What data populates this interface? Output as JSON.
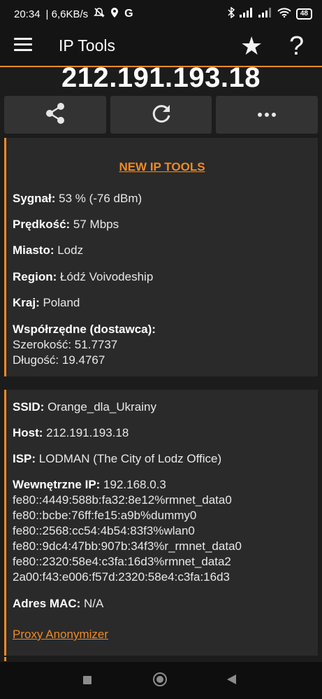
{
  "status_bar": {
    "time": "20:34",
    "net_speed": "| 6,6KB/s",
    "battery": "48",
    "icons": [
      "mute-icon",
      "location-icon",
      "google-icon",
      "bluetooth-icon",
      "signal-icon",
      "signal-icon",
      "wifi-icon",
      "battery-icon"
    ]
  },
  "app_bar": {
    "title": "IP Tools",
    "star_glyph": "★",
    "help_glyph": "?"
  },
  "ip_address": "212.191.193.18",
  "actions": [
    "share-icon",
    "refresh-icon",
    "more-icon"
  ],
  "card1": {
    "new_tools_link": "NEW IP TOOLS",
    "signal_label": "Sygnał:",
    "signal_value": " 53 % (-76 dBm)",
    "speed_label": "Prędkość:",
    "speed_value": " 57 Mbps",
    "city_label": "Miasto:",
    "city_value": " Lodz",
    "region_label": "Region:",
    "region_value": " Łódź Voivodeship",
    "country_label": "Kraj:",
    "country_value": " Poland",
    "coords_label": "Współrzędne (dostawca):",
    "latitude": "Szerokość: 51.7737",
    "longitude": "Długość: 19.4767"
  },
  "card2": {
    "ssid_label": "SSID:",
    "ssid_value": " Orange_dla_Ukrainy",
    "host_label": "Host:",
    "host_value": " 212.191.193.18",
    "isp_label": "ISP:",
    "isp_value": " LODMAN (The City of Lodz Office)",
    "internal_ip_label": "Wewnętrzne IP:",
    "internal_ip_value": " 192.168.0.3",
    "ipv6_lines": [
      "fe80::4449:588b:fa32:8e12%rmnet_data0",
      "fe80::bcbe:76ff:fe15:a9b%dummy0",
      "fe80::2568:cc54:4b54:83f3%wlan0",
      "fe80::9dc4:47bb:907b:34f3%r_rmnet_data0",
      "fe80::2320:58e4:c3fa:16d3%rmnet_data2",
      "2a00:f43:e006:f57d:2320:58e4:c3fa:16d3"
    ],
    "mac_label": "Adres MAC:",
    "mac_value": " N/A",
    "proxy_link": "Proxy Anonymizer"
  },
  "colors": {
    "accent": "#f08a24",
    "background": "#1c1c1c",
    "card": "#2a2a2a",
    "button": "#333333"
  }
}
